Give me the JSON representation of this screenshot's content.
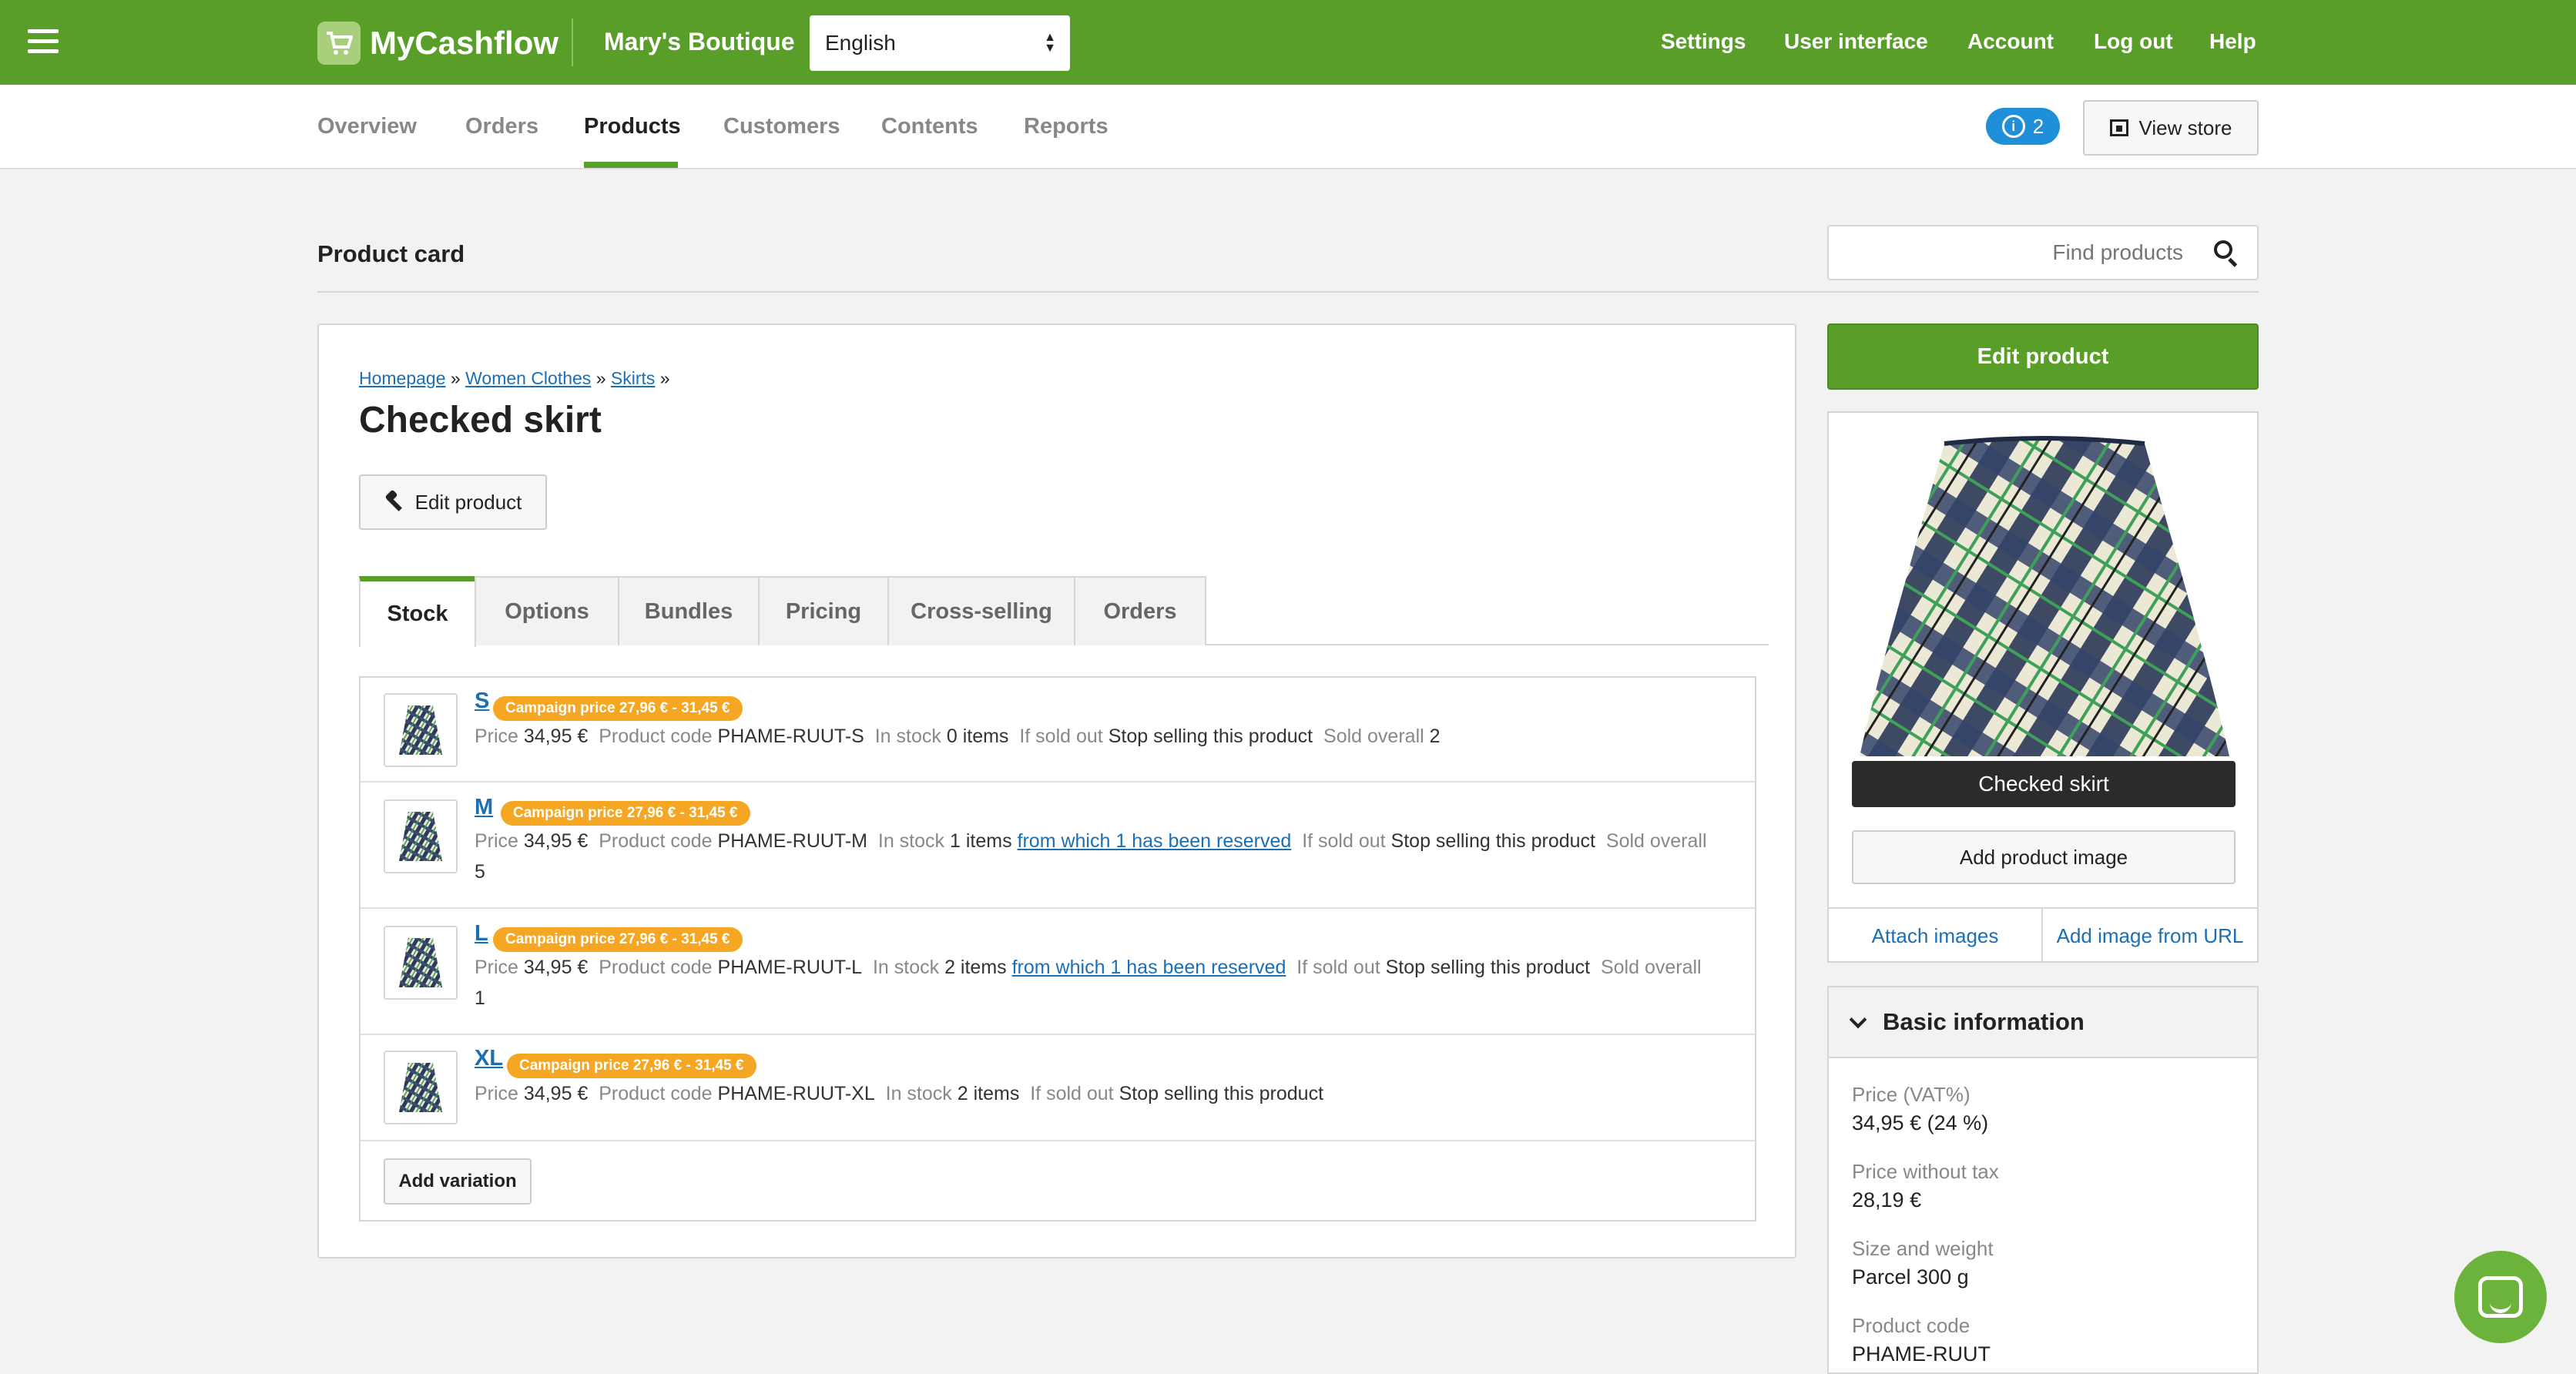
{
  "topbar": {
    "logo_text": "MyCashflow",
    "store_name": "Mary's Boutique",
    "language": "English",
    "nav": [
      "Settings",
      "User interface",
      "Account",
      "Log out",
      "Help"
    ]
  },
  "subnav": {
    "tabs": [
      "Overview",
      "Orders",
      "Products",
      "Customers",
      "Contents",
      "Reports"
    ],
    "active_tab": "Products",
    "notifications_count": "2",
    "view_store_label": "View store"
  },
  "page": {
    "title": "Product card",
    "search_placeholder": "Find products"
  },
  "product": {
    "breadcrumb": [
      "Homepage",
      "Women Clothes",
      "Skirts"
    ],
    "breadcrumb_sep": "»",
    "name": "Checked skirt",
    "edit_label": "Edit product"
  },
  "tabs": [
    "Stock",
    "Options",
    "Bundles",
    "Pricing",
    "Cross-selling",
    "Orders"
  ],
  "labels": {
    "price": "Price",
    "product_code": "Product code",
    "in_stock": "In stock",
    "if_sold_out": "If sold out",
    "sold_overall": "Sold overall"
  },
  "variations": [
    {
      "size": "S",
      "campaign": "Campaign price 27,96 € - 31,45 €",
      "price": "34,95 €",
      "code": "PHAME-RUUT-S",
      "stock": "0 items",
      "reserved": "",
      "sold_out": "Stop selling this product",
      "sold": "2"
    },
    {
      "size": "M",
      "campaign": "Campaign price 27,96 € - 31,45 €",
      "price": "34,95 €",
      "code": "PHAME-RUUT-M",
      "stock": "1 items",
      "reserved": "from which 1 has been reserved",
      "sold_out": "Stop selling this product",
      "sold": "5"
    },
    {
      "size": "L",
      "campaign": "Campaign price 27,96 € - 31,45 €",
      "price": "34,95 €",
      "code": "PHAME-RUUT-L",
      "stock": "2 items",
      "reserved": "from which 1 has been reserved",
      "sold_out": "Stop selling this product",
      "sold": "1"
    },
    {
      "size": "XL",
      "campaign": "Campaign price 27,96 € - 31,45 €",
      "price": "34,95 €",
      "code": "PHAME-RUUT-XL",
      "stock": "2 items",
      "reserved": "",
      "sold_out": "Stop selling this product",
      "sold": ""
    }
  ],
  "add_variation_label": "Add variation",
  "sidebar": {
    "edit_product_label": "Edit product",
    "image_caption": "Checked skirt",
    "add_image_label": "Add product image",
    "attach_images_label": "Attach images",
    "add_from_url_label": "Add image from URL",
    "basic_info_title": "Basic information",
    "basic_info": [
      {
        "label": "Price (VAT%)",
        "value": "34,95 € (24 %)"
      },
      {
        "label": "Price without tax",
        "value": "28,19 €"
      },
      {
        "label": "Size and weight",
        "value": "Parcel 300 g"
      },
      {
        "label": "Product code",
        "value": "PHAME-RUUT"
      }
    ]
  },
  "colors": {
    "brand_green": "#5a9e2a",
    "campaign_orange": "#f5a623",
    "link_blue": "#1a6fb5",
    "badge_blue": "#1e8fd8"
  }
}
